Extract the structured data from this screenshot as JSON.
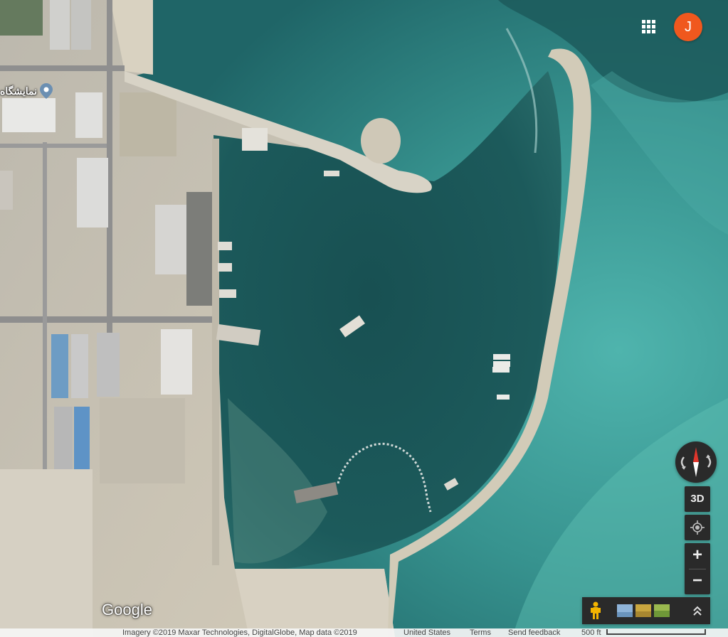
{
  "map": {
    "view": "satellite",
    "place_label": "نمایشگاه",
    "logo": "Google",
    "watermark": "©2019 Google"
  },
  "header": {
    "apps_icon": "grid-icon",
    "account_initial": "J",
    "account_color": "#f0581e"
  },
  "controls": {
    "three_d_label": "3D",
    "zoom_in_label": "+",
    "zoom_out_label": "−",
    "compass_icon": "compass-icon",
    "locate_icon": "my-location-icon",
    "pegman_icon": "pegman-icon",
    "expand_icon": "chevron-up-icon"
  },
  "footer": {
    "imagery": "Imagery ©2019 Maxar Technologies, DigitalGlobe, Map data ©2019",
    "country": "United States",
    "terms": "Terms",
    "feedback": "Send feedback",
    "scale": "500 ft"
  },
  "colors": {
    "harbor_water": "#1c5253",
    "open_sea": "#3a9c98",
    "land": "#c9c2b3",
    "control_bg": "#2a2a2a"
  }
}
